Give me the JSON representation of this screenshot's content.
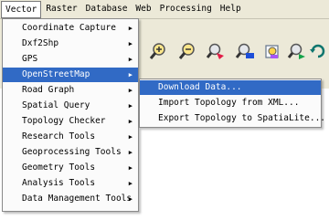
{
  "menubar": {
    "items": [
      {
        "label": "Vector"
      },
      {
        "label": "Raster"
      },
      {
        "label": "Database"
      },
      {
        "label": "Web"
      },
      {
        "label": "Processing"
      },
      {
        "label": "Help"
      }
    ]
  },
  "vector_menu": {
    "items": [
      {
        "label": "Coordinate Capture"
      },
      {
        "label": "Dxf2Shp"
      },
      {
        "label": "GPS"
      },
      {
        "label": "OpenStreetMap"
      },
      {
        "label": "Road Graph"
      },
      {
        "label": "Spatial Query"
      },
      {
        "label": "Topology Checker"
      },
      {
        "label": "Research Tools"
      },
      {
        "label": "Geoprocessing Tools"
      },
      {
        "label": "Geometry Tools"
      },
      {
        "label": "Analysis Tools"
      },
      {
        "label": "Data Management Tools"
      }
    ],
    "submenu_arrow": "▶"
  },
  "openstreetmap_submenu": {
    "items": [
      {
        "label": "Download Data..."
      },
      {
        "label": "Import Topology from XML..."
      },
      {
        "label": "Export Topology to SpatiaLite..."
      }
    ]
  },
  "toolbar": {
    "icons": [
      "zoom-in-icon",
      "zoom-out-icon",
      "zoom-to-selection-icon",
      "zoom-to-layer-icon",
      "zoom-last-icon",
      "zoom-next-icon",
      "refresh-icon"
    ]
  },
  "colors": {
    "highlight": "#316ac5",
    "menu_background": "#fbfbfb",
    "chrome_background": "#ece9d8"
  }
}
